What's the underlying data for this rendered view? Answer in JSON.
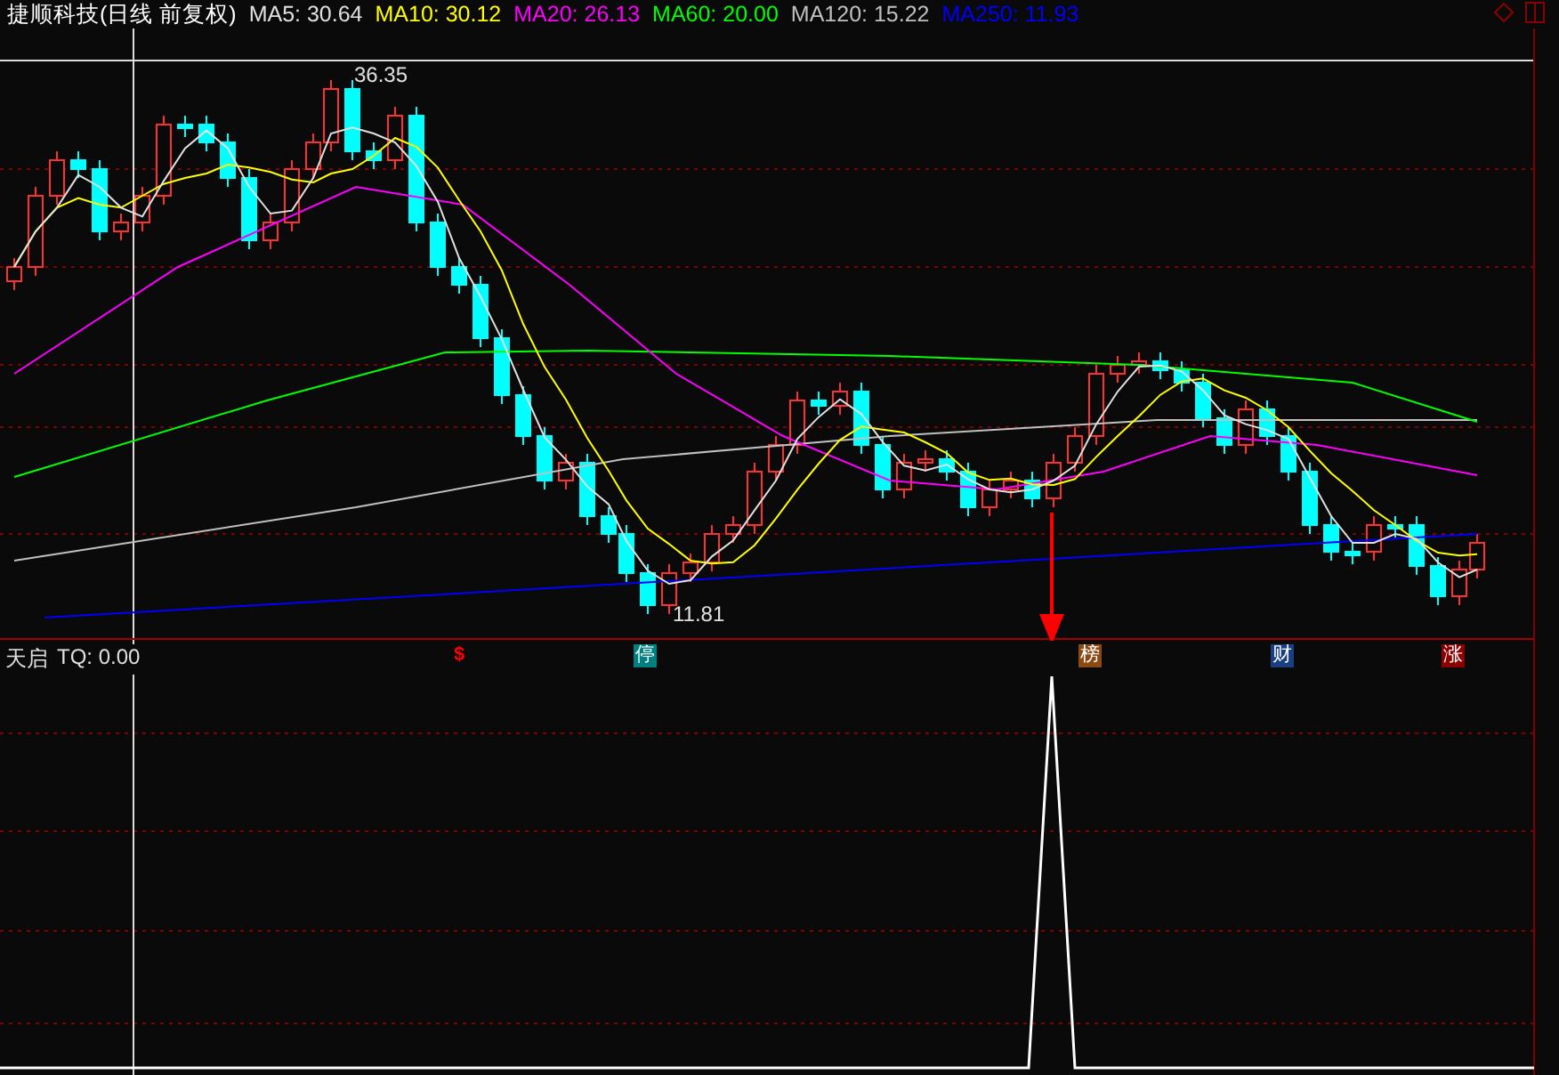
{
  "header": {
    "title": "捷顺科技(日线 前复权)",
    "indicators": [
      {
        "label": "MA5: 30.64",
        "color": "#e0e0e0"
      },
      {
        "label": "MA10: 30.12",
        "color": "#ffff00"
      },
      {
        "label": "MA20: 26.13",
        "color": "#ff00ff"
      },
      {
        "label": "MA60: 20.00",
        "color": "#00ff00"
      },
      {
        "label": "MA120: 15.22",
        "color": "#c0c0c0"
      },
      {
        "label": "MA250: 11.93",
        "color": "#0000ff"
      }
    ]
  },
  "price_labels": [
    {
      "text": "36.35"
    },
    {
      "text": "11.81"
    }
  ],
  "markers": [
    {
      "text": "$",
      "kind": "symbol",
      "color": "#ff0000"
    },
    {
      "text": "停",
      "kind": "tag",
      "color": "#008080"
    },
    {
      "text": "榜",
      "kind": "tag",
      "color": "#8b4a14"
    },
    {
      "text": "财",
      "kind": "tag",
      "color": "#173f82"
    },
    {
      "text": "涨",
      "kind": "tag",
      "color": "#8b0000"
    }
  ],
  "lower_panel": {
    "title": "天启",
    "reading": "TQ: 0.00"
  }
}
